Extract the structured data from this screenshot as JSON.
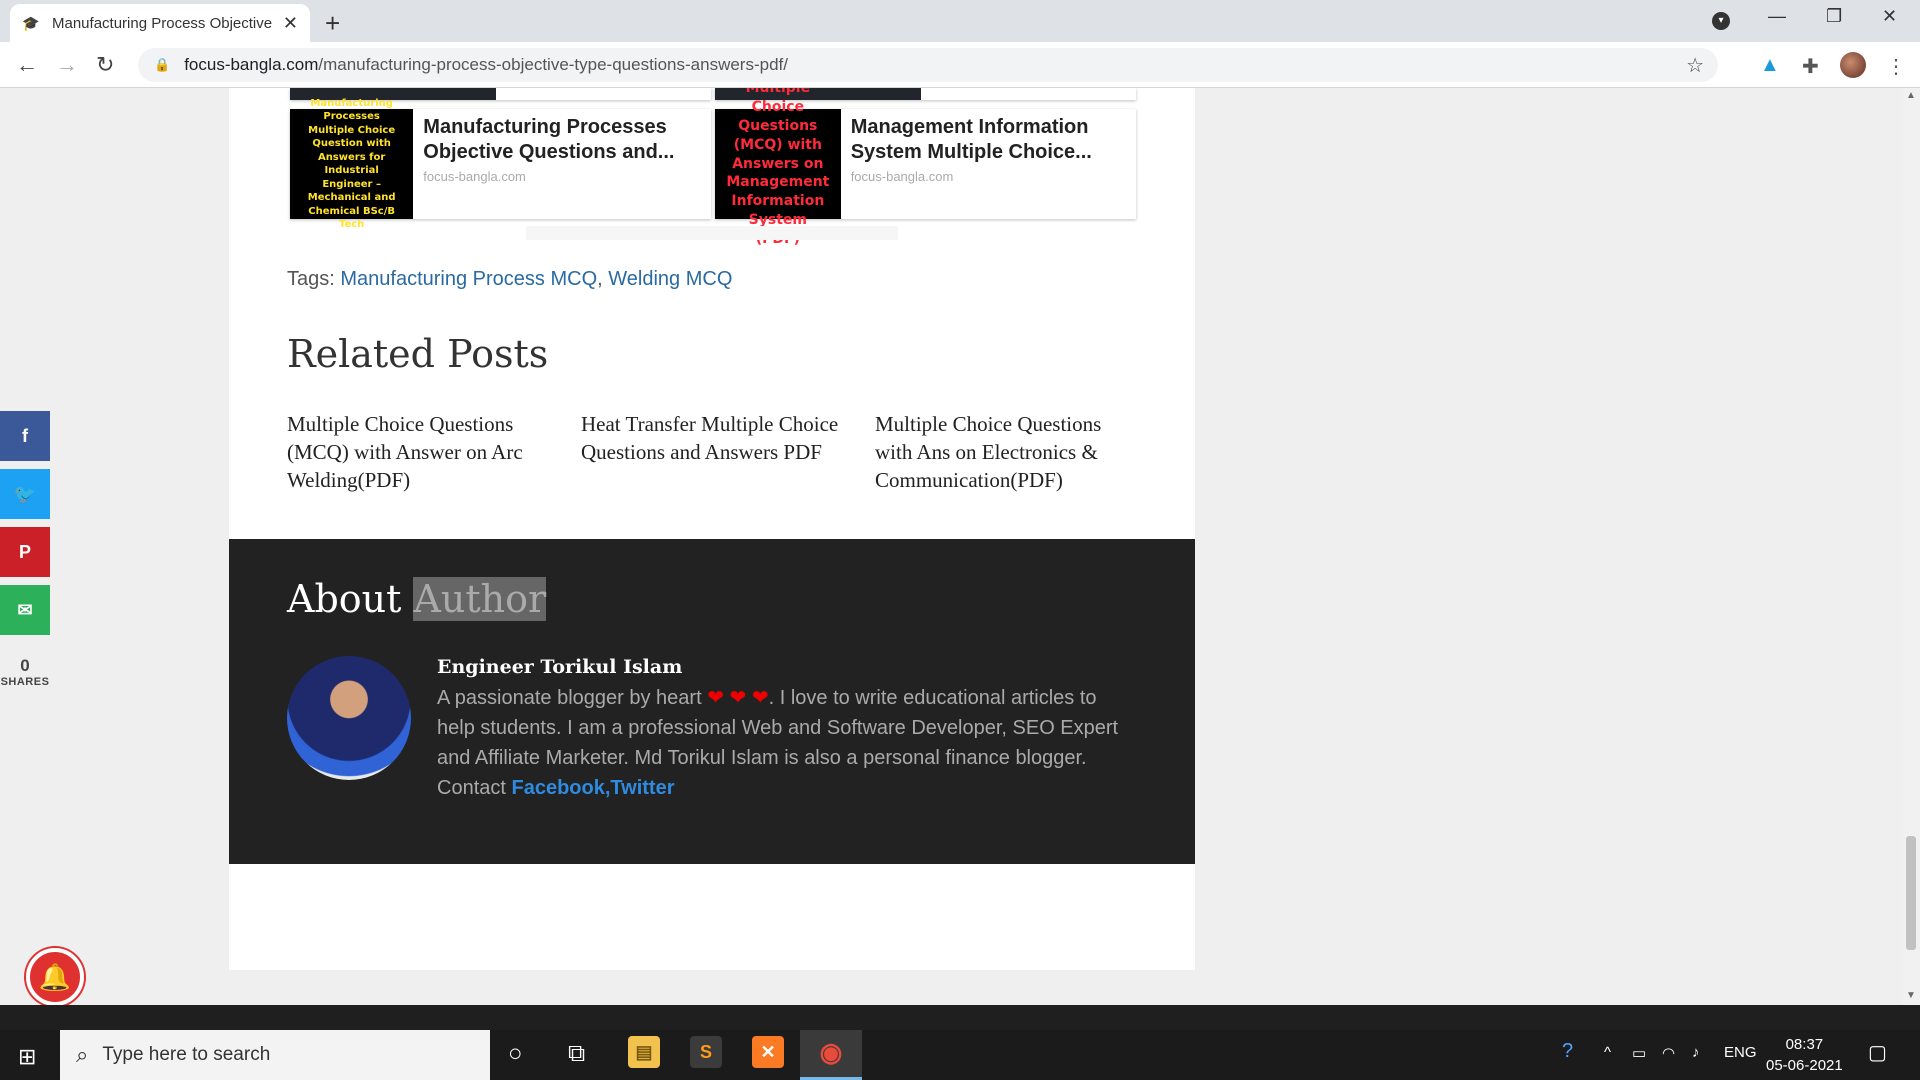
{
  "browser": {
    "tab_title": "Manufacturing Process Objective Type Questions Answers PDF",
    "tab_close": "✕",
    "new_tab": "+",
    "url_host": "focus-bangla.com",
    "url_path": "/manufacturing-process-objective-type-questions-answers-pdf/"
  },
  "cards": [
    {
      "thumb_text": "Manufacturing Processes Multiple Choice Question with Answers for Industrial Engineer –Mechanical and Chemical BSc/B Tech",
      "title": "Manufacturing Processes Objective Questions and...",
      "source": "focus-bangla.com"
    },
    {
      "thumb_text": "Multiple Choice Questions (MCQ) with Answers on Management Information System (PDF)",
      "title": "Management Information System Multiple Choice...",
      "source": "focus-bangla.com"
    }
  ],
  "tags": {
    "label": "Tags:",
    "items": [
      "Manufacturing Process MCQ",
      "Welding MCQ"
    ],
    "sep": ", "
  },
  "related": {
    "heading": "Related Posts",
    "posts": [
      "Multiple Choice Questions (MCQ) with Answer on Arc Welding(PDF)",
      "Heat Transfer Multiple Choice Questions and Answers PDF",
      "Multiple Choice Questions with Ans on Electronics & Communication(PDF)"
    ]
  },
  "author": {
    "heading_1": "About",
    "heading_2": "Author",
    "name": "Engineer Torikul Islam",
    "bio_1": "A passionate blogger by heart",
    "hearts": "❤ ❤ ❤",
    "bio_2": ". I love to write educational articles to help students. I am a professional Web and Software Developer, SEO Expert and Affiliate Marketer. Md Torikul Islam is also a personal finance blogger. Contact",
    "link_facebook": "Facebook",
    "link_sep": ",",
    "link_twitter": "Twitter"
  },
  "share": {
    "count": "0",
    "label": "SHARES",
    "facebook_color": "#3b5998",
    "twitter_color": "#1da1f2",
    "pinterest_color": "#cb2027",
    "email_color": "#2db05a"
  },
  "taskbar": {
    "search_placeholder": "Type here to search",
    "lang": "ENG",
    "time": "08:37",
    "date": "05-06-2021"
  }
}
